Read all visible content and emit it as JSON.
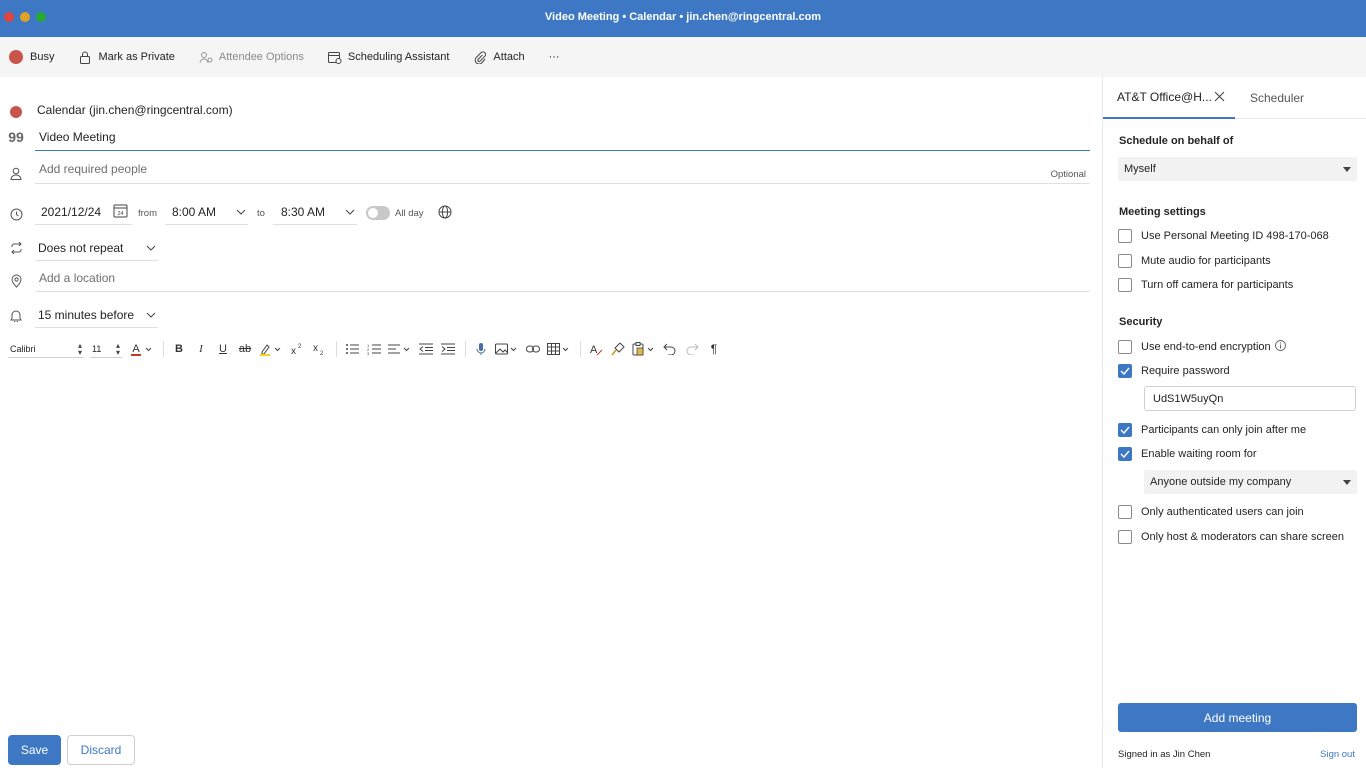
{
  "window": {
    "title": "Video Meeting • Calendar • jin.chen@ringcentral.com"
  },
  "toolbar": {
    "busy": "Busy",
    "mark_private": "Mark as Private",
    "attendee_options": "Attendee Options",
    "scheduling_assistant": "Scheduling Assistant",
    "attach": "Attach",
    "more": "···"
  },
  "form": {
    "calendar": "Calendar (jin.chen@ringcentral.com)",
    "title_value": "Video Meeting",
    "people_placeholder": "Add required people",
    "optional_label": "Optional",
    "date": "2021/12/24",
    "from_label": "from",
    "start_time": "8:00 AM",
    "to_label": "to",
    "end_time": "8:30 AM",
    "all_day_label": "All day",
    "repeat": "Does not repeat",
    "location_placeholder": "Add a location",
    "reminder": "15 minutes before",
    "calendar_day_badge": "24"
  },
  "editor": {
    "font_name": "Calibri",
    "font_size": "11"
  },
  "actions": {
    "save": "Save",
    "discard": "Discard"
  },
  "panel": {
    "tab_active": "AT&T Office@H...",
    "tab_scheduler": "Scheduler",
    "schedule_behalf_title": "Schedule on behalf of",
    "behalf_value": "Myself",
    "meeting_settings_title": "Meeting settings",
    "settings": [
      {
        "label": "Use Personal Meeting ID 498-170-068",
        "checked": false
      },
      {
        "label": "Mute audio for participants",
        "checked": false
      },
      {
        "label": "Turn off camera for participants",
        "checked": false
      }
    ],
    "security_title": "Security",
    "security": {
      "e2e": "Use end-to-end encryption",
      "require_password": "Require password",
      "password_value": "UdS1W5uyQn",
      "join_after_me": "Participants can only join after me",
      "waiting_room": "Enable waiting room for",
      "waiting_room_value": "Anyone outside my company",
      "authenticated_only": "Only authenticated users can join",
      "host_share": "Only host & moderators can share screen"
    },
    "add_meeting": "Add meeting",
    "signed_in": "Signed in as Jin Chen",
    "sign_out": "Sign out"
  },
  "colors": {
    "accent": "#3e78c5",
    "busy": "#c8564b"
  }
}
